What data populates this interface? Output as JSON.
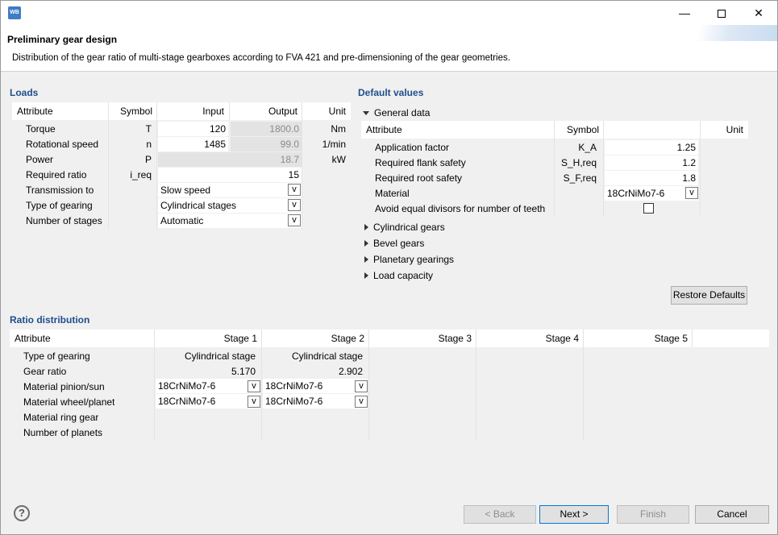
{
  "window": {
    "app_icon_text": "WB",
    "minimize_glyph": "—",
    "close_glyph": "✕"
  },
  "header": {
    "title": "Preliminary gear design",
    "description": "Distribution of the gear ratio of multi-stage gearboxes according to FVA 421 and pre-dimensioning of the gear geometries."
  },
  "loads": {
    "title": "Loads",
    "headers": {
      "attribute": "Attribute",
      "symbol": "Symbol",
      "input": "Input",
      "output": "Output",
      "unit": "Unit"
    },
    "rows": [
      {
        "attribute": "Torque",
        "symbol": "T",
        "input": "120",
        "output": "1800.0",
        "unit": "Nm"
      },
      {
        "attribute": "Rotational speed",
        "symbol": "n",
        "input": "1485",
        "output": "99.0",
        "unit": "1/min"
      },
      {
        "attribute": "Power",
        "symbol": "P",
        "input": "",
        "output": "18.7",
        "unit": "kW"
      },
      {
        "attribute": "Required ratio",
        "symbol": "i_req",
        "input": "15",
        "output": "",
        "unit": ""
      },
      {
        "attribute": "Transmission to",
        "symbol": "",
        "input": "Slow speed",
        "output": "",
        "unit": ""
      },
      {
        "attribute": "Type of gearing",
        "symbol": "",
        "input": "Cylindrical stages",
        "output": "",
        "unit": ""
      },
      {
        "attribute": "Number of stages",
        "symbol": "",
        "input": "Automatic",
        "output": "",
        "unit": ""
      }
    ]
  },
  "defaults": {
    "title": "Default values",
    "general": {
      "label": "General data",
      "headers": {
        "attribute": "Attribute",
        "symbol": "Symbol",
        "value": "",
        "unit": "Unit"
      },
      "rows": [
        {
          "attribute": "Application factor",
          "symbol": "K_A",
          "value": "1.25"
        },
        {
          "attribute": "Required flank safety",
          "symbol": "S_H,req",
          "value": "1.2"
        },
        {
          "attribute": "Required root safety",
          "symbol": "S_F,req",
          "value": "1.8"
        },
        {
          "attribute": "Material",
          "symbol": "",
          "value": "18CrNiMo7-6"
        },
        {
          "attribute": "Avoid equal divisors for number of teeth",
          "symbol": "",
          "value": ""
        }
      ]
    },
    "collapsed": [
      "Cylindrical gears",
      "Bevel gears",
      "Planetary gearings",
      "Load capacity"
    ],
    "restore_label": "Restore Defaults"
  },
  "ratio": {
    "title": "Ratio distribution",
    "headers": [
      "Attribute",
      "Stage 1",
      "Stage 2",
      "Stage 3",
      "Stage 4",
      "Stage 5"
    ],
    "rows": [
      {
        "attribute": "Type of gearing",
        "s1": "Cylindrical stage",
        "s2": "Cylindrical stage"
      },
      {
        "attribute": "Gear ratio",
        "s1": "5.170",
        "s2": "2.902"
      },
      {
        "attribute": "Material pinion/sun",
        "s1": "18CrNiMo7-6",
        "s2": "18CrNiMo7-6"
      },
      {
        "attribute": "Material wheel/planet",
        "s1": "18CrNiMo7-6",
        "s2": "18CrNiMo7-6"
      },
      {
        "attribute": "Material ring gear",
        "s1": "",
        "s2": ""
      },
      {
        "attribute": "Number of planets",
        "s1": "",
        "s2": ""
      }
    ]
  },
  "footer": {
    "help_glyph": "?",
    "back": "< Back",
    "next": "Next >",
    "finish": "Finish",
    "cancel": "Cancel"
  },
  "combo_glyph": "v"
}
